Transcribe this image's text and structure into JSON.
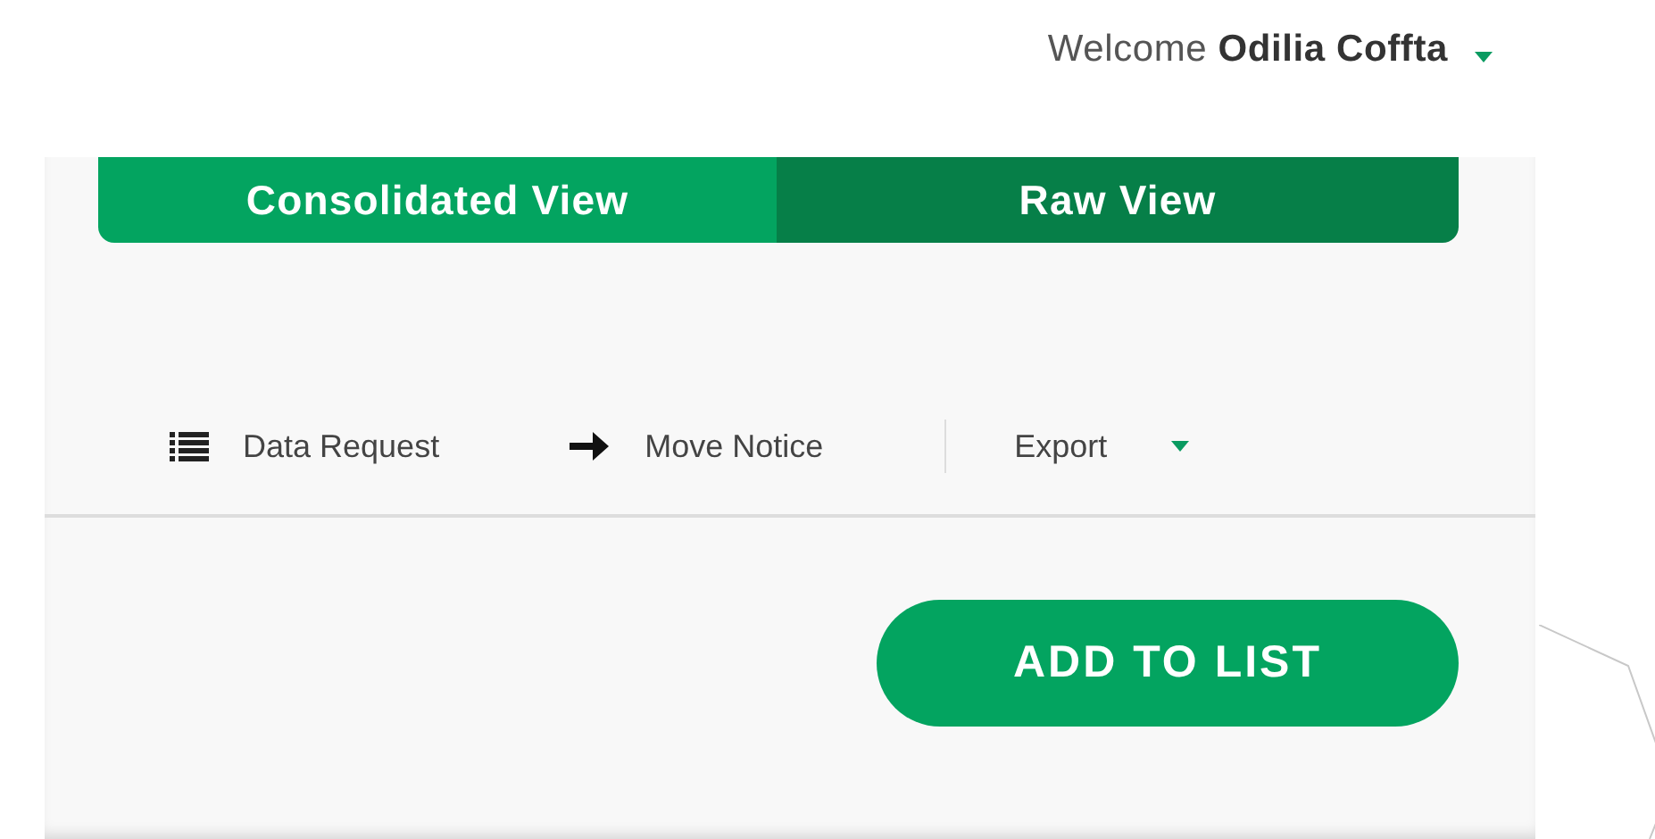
{
  "header": {
    "greeting": "Welcome",
    "user_name": "Odilia Coffta"
  },
  "view_toggle": [
    {
      "label": "Consolidated View",
      "selected": false
    },
    {
      "label": "Raw View",
      "selected": true
    }
  ],
  "toolbar": [
    {
      "kind": "list",
      "label": "Data Request"
    },
    {
      "kind": "arrow",
      "label": "Move Notice"
    },
    {
      "kind": "dropdown",
      "label": "Export"
    }
  ],
  "primary_button": "ADD TO LIST"
}
